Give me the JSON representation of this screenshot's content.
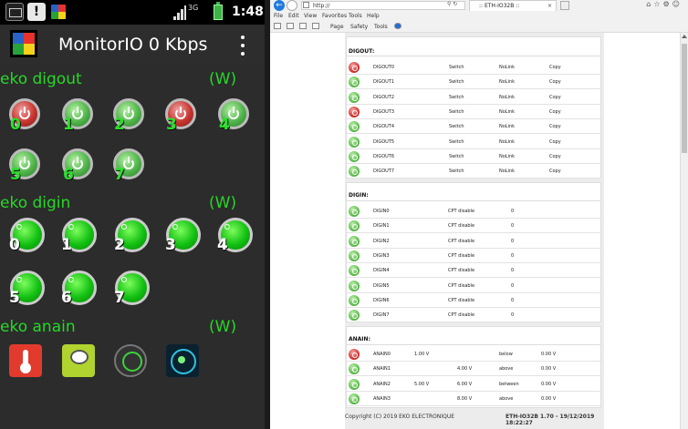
{
  "phone": {
    "status_bar": {
      "time": "1:48",
      "network": "3G",
      "alert_glyph": "!"
    },
    "app": {
      "title": "MonitorIO 0 Kbps"
    },
    "sections": {
      "digout": {
        "title": "eko digout",
        "mode": "(W)",
        "items": [
          {
            "label": "0",
            "state": "off"
          },
          {
            "label": "1",
            "state": "on"
          },
          {
            "label": "2",
            "state": "on"
          },
          {
            "label": "3",
            "state": "off"
          },
          {
            "label": "4",
            "state": "on"
          },
          {
            "label": "5",
            "state": "on"
          },
          {
            "label": "6",
            "state": "on"
          },
          {
            "label": "7",
            "state": "on"
          }
        ]
      },
      "digin": {
        "title": "eko digin",
        "mode": "(W)",
        "items": [
          "0",
          "1",
          "2",
          "3",
          "4",
          "5",
          "6",
          "7"
        ]
      },
      "anain": {
        "title": "eko anain",
        "mode": "(W)",
        "icons": [
          "thermometer-icon",
          "scale-icon",
          "gauge-icon",
          "radar-icon"
        ]
      }
    }
  },
  "browser": {
    "address": "http://",
    "tab_title": ":: ETH-IO32B ::",
    "menu": [
      "File",
      "Edit",
      "View",
      "Favorites",
      "Tools",
      "Help"
    ],
    "commands": [
      "Page",
      "Safety",
      "Tools"
    ],
    "digout": {
      "title": "DIGOUT:",
      "rows": [
        {
          "name": "DIGOUT0",
          "type": "Switch",
          "link": "NoLink",
          "action": "Copy",
          "state": "off"
        },
        {
          "name": "DIGOUT1",
          "type": "Switch",
          "link": "NoLink",
          "action": "Copy",
          "state": "on"
        },
        {
          "name": "DIGOUT2",
          "type": "Switch",
          "link": "NoLink",
          "action": "Copy",
          "state": "on"
        },
        {
          "name": "DIGOUT3",
          "type": "Switch",
          "link": "NoLink",
          "action": "Copy",
          "state": "off"
        },
        {
          "name": "DIGOUT4",
          "type": "Switch",
          "link": "NoLink",
          "action": "Copy",
          "state": "on"
        },
        {
          "name": "DIGOUT5",
          "type": "Switch",
          "link": "NoLink",
          "action": "Copy",
          "state": "on"
        },
        {
          "name": "DIGOUT6",
          "type": "Switch",
          "link": "NoLink",
          "action": "Copy",
          "state": "on"
        },
        {
          "name": "DIGOUT7",
          "type": "Switch",
          "link": "NoLink",
          "action": "Copy",
          "state": "on"
        }
      ]
    },
    "digin": {
      "title": "DIGIN:",
      "rows": [
        {
          "name": "DIGIN0",
          "mode": "CPT disable",
          "count": "0"
        },
        {
          "name": "DIGIN1",
          "mode": "CPT disable",
          "count": "0"
        },
        {
          "name": "DIGIN2",
          "mode": "CPT disable",
          "count": "0"
        },
        {
          "name": "DIGIN3",
          "mode": "CPT disable",
          "count": "0"
        },
        {
          "name": "DIGIN4",
          "mode": "CPT disable",
          "count": "0"
        },
        {
          "name": "DIGIN5",
          "mode": "CPT disable",
          "count": "0"
        },
        {
          "name": "DIGIN6",
          "mode": "CPT disable",
          "count": "0"
        },
        {
          "name": "DIGIN7",
          "mode": "CPT disable",
          "count": "0"
        }
      ]
    },
    "anain": {
      "title": "ANAIN:",
      "rows": [
        {
          "name": "ANAIN0",
          "low": "1.00 V",
          "high": "",
          "cond": "below",
          "value": "0.00 V",
          "state": "off"
        },
        {
          "name": "ANAIN1",
          "low": "",
          "high": "4.00 V",
          "cond": "above",
          "value": "0.00 V",
          "state": "on"
        },
        {
          "name": "ANAIN2",
          "low": "5.00 V",
          "high": "6.00 V",
          "cond": "between",
          "value": "0.00 V",
          "state": "on"
        },
        {
          "name": "ANAIN3",
          "low": "",
          "high": "8.00 V",
          "cond": "above",
          "value": "0.00 V",
          "state": "on"
        }
      ]
    },
    "footer": {
      "copyright": "Copyright (C) 2019 EKO ELECTRONIQUE",
      "version": "ETH-IO32B 1.70 - 19/12/2019 18:22:27"
    }
  }
}
